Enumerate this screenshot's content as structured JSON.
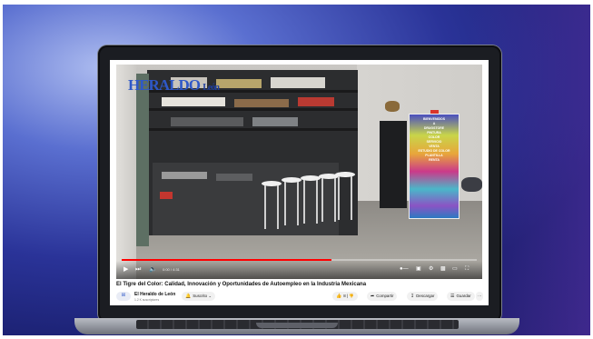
{
  "video": {
    "channel_logo": "HERALDO",
    "channel_logo_sub": "León",
    "banner_lines": [
      "BIENVENIDOS",
      "A",
      "DRUGSTORE",
      "PINTURA",
      "COLOR",
      "SERVICIO",
      "VENTA",
      "ESTUDIO DE COLOR",
      "PLANTILLA",
      "RENTA"
    ],
    "progress_fraction": 0.59,
    "time_display": "0:00 / 4:31",
    "colors": {
      "progress": "#ff0000",
      "logo": "#2e58c8"
    }
  },
  "controls": {
    "play_icon": "play-icon",
    "next_icon": "next-icon",
    "volume_icon": "volume-icon",
    "right_icons": [
      "autoplay-toggle",
      "subtitles-icon",
      "settings-icon",
      "miniplayer-icon",
      "theater-icon",
      "fullscreen-icon"
    ]
  },
  "info": {
    "title": "El Tigre del Color: Calidad, Innovación y Oportunidades de Autoempleo en la Industria Mexicana",
    "channel_name": "El Heraldo de León",
    "channel_avatar": "H",
    "subscribers": "1.2 K suscriptores",
    "subscribe_label": "Suscrito",
    "like_count": "8",
    "share_label": "Compartir",
    "download_label": "Descargar",
    "save_label": "Guardar",
    "more_label": "···"
  }
}
